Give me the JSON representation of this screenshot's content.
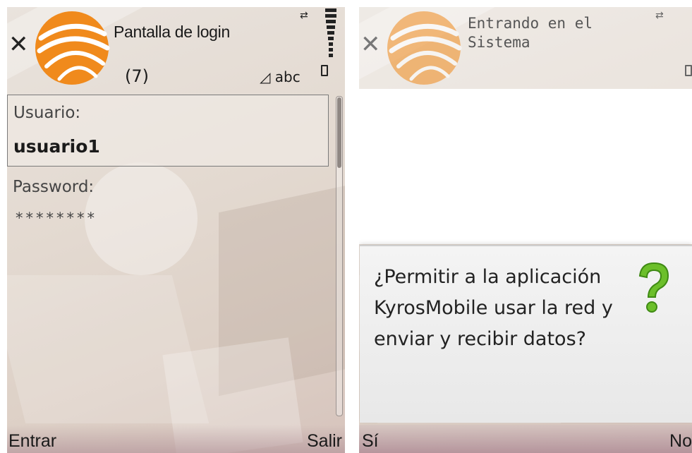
{
  "left_screen": {
    "title": "Pantalla de login",
    "count": "(7)",
    "input_mode": "abc",
    "fields": [
      {
        "label": "Usuario:",
        "value": "usuario1"
      },
      {
        "label": "Password:",
        "value": "********"
      }
    ],
    "softkeys": {
      "left": "Entrar",
      "right": "Salir"
    },
    "icons": {
      "close": "close-icon",
      "logo": "app-logo",
      "battery": "battery-icon",
      "mode": "edit-mode-icon"
    }
  },
  "right_screen": {
    "title_line1": "Entrando en el",
    "title_line2": "Sistema",
    "dialog": {
      "message": "¿Permitir a la aplicación KyrosMobile usar la red y enviar y recibir datos?"
    },
    "softkeys": {
      "left": "Sí",
      "right": "No"
    }
  },
  "colors": {
    "logo_orange": "#f08a1c",
    "background": "#e5dcd4"
  }
}
